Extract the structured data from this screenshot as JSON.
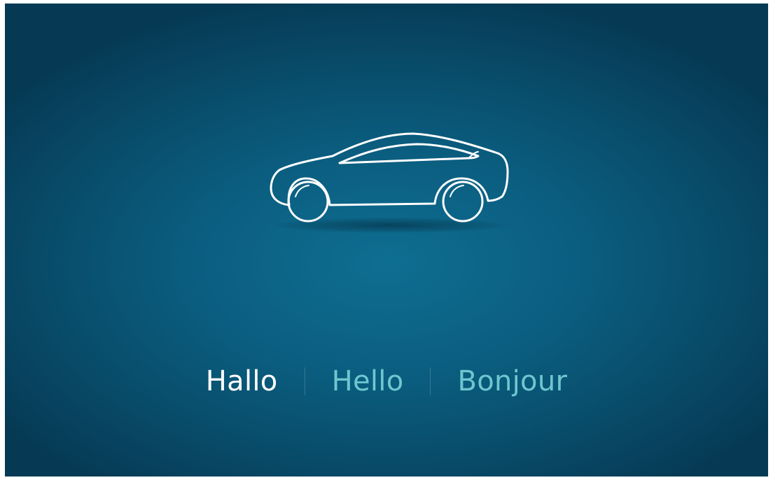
{
  "icon": "car-outline-icon",
  "languages": {
    "items": [
      {
        "label": "Hallo",
        "active": true
      },
      {
        "label": "Hello",
        "active": false
      },
      {
        "label": "Bonjour",
        "active": false
      }
    ],
    "active_color": "#ffffff",
    "inactive_color": "#6ec7cf"
  },
  "colors": {
    "background_center": "#0e6e92",
    "background_edge": "#063a54",
    "car_stroke": "#ffffff"
  }
}
